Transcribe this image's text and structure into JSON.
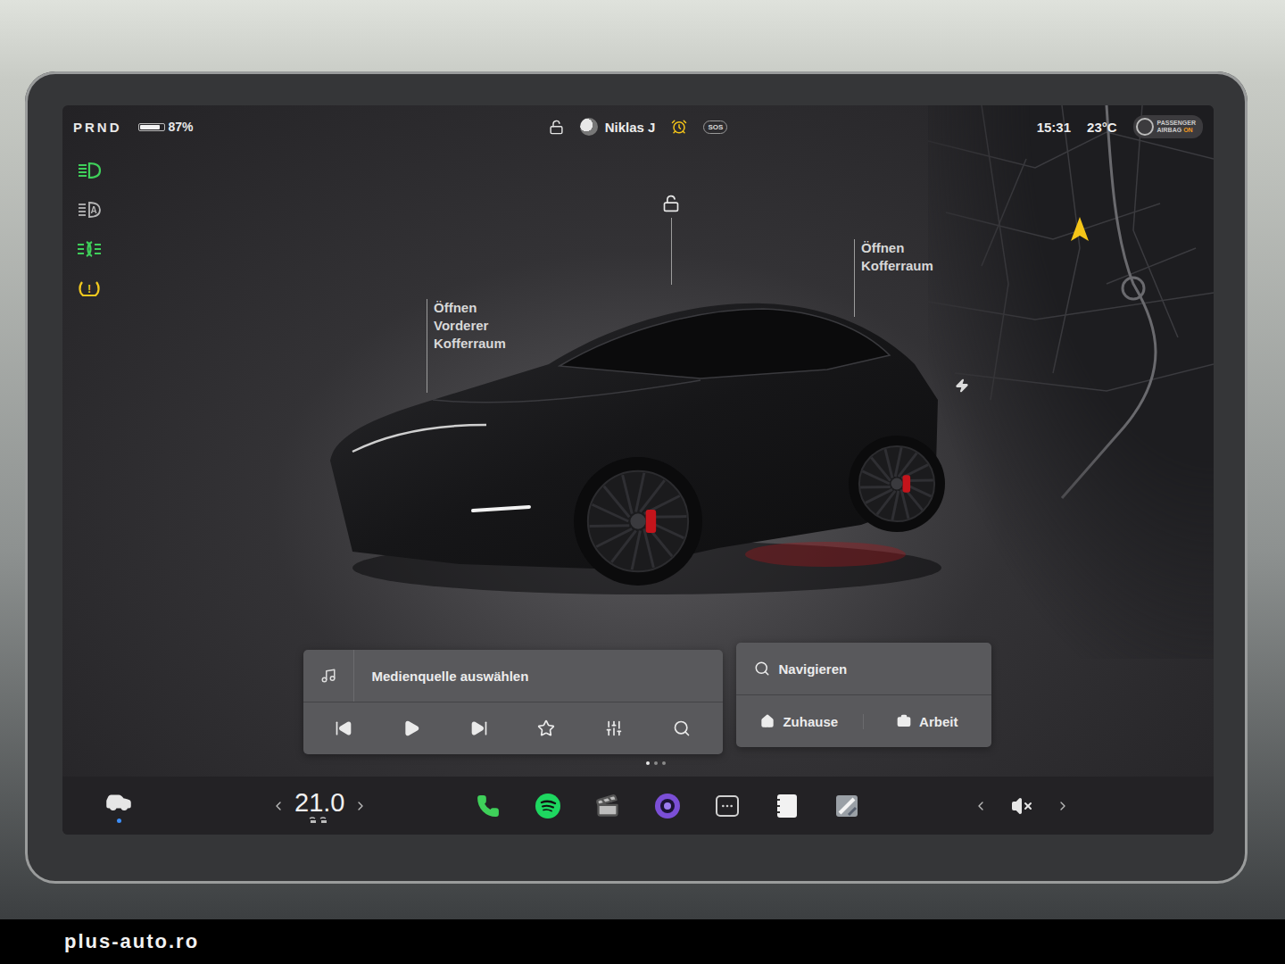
{
  "watermark": "plus-auto.ro",
  "status_bar": {
    "gears": "PRND",
    "battery": {
      "reading": "87%",
      "level": 0.87
    },
    "profile": "Niklas J",
    "sos": "SOS",
    "time": "15:31",
    "temperature": "23°C",
    "airbag": {
      "line1": "PASSENGER",
      "line2": "AIRBAG",
      "state": "ON"
    }
  },
  "indicators": [
    {
      "kind": "headlights",
      "on": true,
      "color": "#3fd05a"
    },
    {
      "kind": "auto-high-beam",
      "mark": "A",
      "on": false,
      "color": "#cfcfcf"
    },
    {
      "kind": "fog-lights",
      "on": true,
      "color": "#3fd05a"
    },
    {
      "kind": "tire-pressure",
      "mark": "!",
      "on": true,
      "color": "#f2c81e"
    }
  ],
  "car": {
    "front_trunk": [
      "Öffnen",
      "Vorderer",
      "Kofferraum"
    ],
    "trunk": [
      "Öffnen",
      "Kofferraum"
    ],
    "locked": false,
    "charge_port": true
  },
  "media": {
    "source": "Medienquelle auswählen",
    "controls": [
      "previous",
      "play",
      "next",
      "favorite",
      "equalizer",
      "search"
    ]
  },
  "navigation": {
    "placeholder": "Navigieren",
    "shortcuts": [
      {
        "kind": "home",
        "label": "Zuhause"
      },
      {
        "kind": "work",
        "label": "Arbeit"
      }
    ]
  },
  "page_dots": [
    {
      "selected": true
    },
    {
      "selected": false
    },
    {
      "selected": false
    }
  ],
  "dock": {
    "climate": "21.0",
    "muted": true,
    "apps": [
      {
        "kind": "phone",
        "color": "#3fd05a"
      },
      {
        "kind": "spotify",
        "color": "#1ed760"
      },
      {
        "kind": "theater",
        "color": "#bdbdbd"
      },
      {
        "kind": "camera",
        "color": "#7b4fd6"
      },
      {
        "kind": "more",
        "color": "#d0d0d0"
      },
      {
        "kind": "notes",
        "color": "#f2f2f2"
      },
      {
        "kind": "toybox",
        "color": "#9aa0a6"
      }
    ]
  }
}
